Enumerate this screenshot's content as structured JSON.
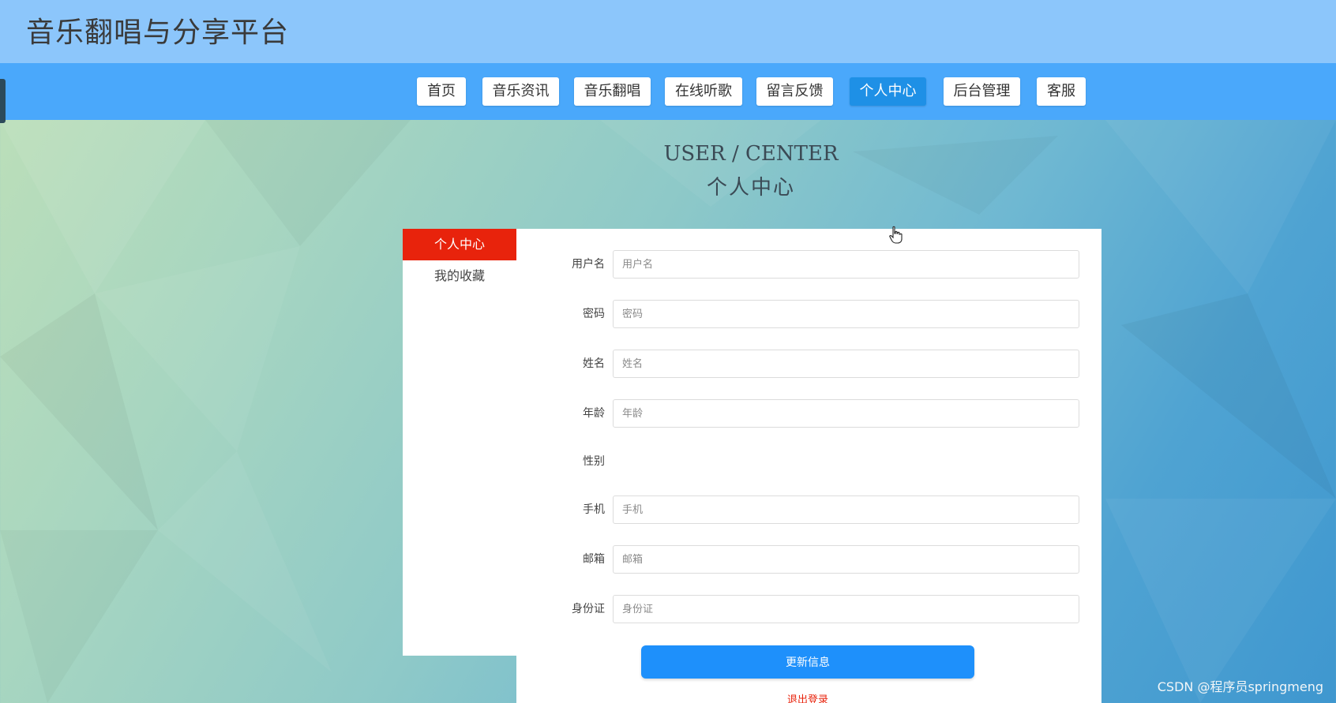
{
  "header": {
    "site_title": "音乐翻唱与分享平台"
  },
  "nav": {
    "items": [
      {
        "label": "首页"
      },
      {
        "label": "音乐资讯"
      },
      {
        "label": "音乐翻唱"
      },
      {
        "label": "在线听歌"
      },
      {
        "label": "留言反馈"
      },
      {
        "label": "个人中心",
        "active": true
      },
      {
        "label": "后台管理"
      },
      {
        "label": "客服"
      }
    ]
  },
  "page": {
    "heading_en": "USER / CENTER",
    "heading_zh": "个人中心"
  },
  "side_menu": {
    "items": [
      {
        "label": "个人中心",
        "active": true
      },
      {
        "label": "我的收藏"
      }
    ]
  },
  "form": {
    "fields": [
      {
        "label": "用户名",
        "placeholder": "用户名",
        "value": ""
      },
      {
        "label": "密码",
        "placeholder": "密码",
        "value": ""
      },
      {
        "label": "姓名",
        "placeholder": "姓名",
        "value": ""
      },
      {
        "label": "年龄",
        "placeholder": "年龄",
        "value": ""
      },
      {
        "label": "性别"
      },
      {
        "label": "手机",
        "placeholder": "手机",
        "value": ""
      },
      {
        "label": "邮箱",
        "placeholder": "邮箱",
        "value": ""
      },
      {
        "label": "身份证",
        "placeholder": "身份证",
        "value": ""
      }
    ],
    "submit_label": "更新信息",
    "logout_label": "退出登录"
  },
  "watermark": "CSDN @程序员springmeng",
  "colors": {
    "header_bg": "#8cc6fb",
    "nav_bg": "#4aa8fb",
    "nav_active": "#1e90e6",
    "side_active": "#e8230c",
    "button": "#1e90fb"
  }
}
